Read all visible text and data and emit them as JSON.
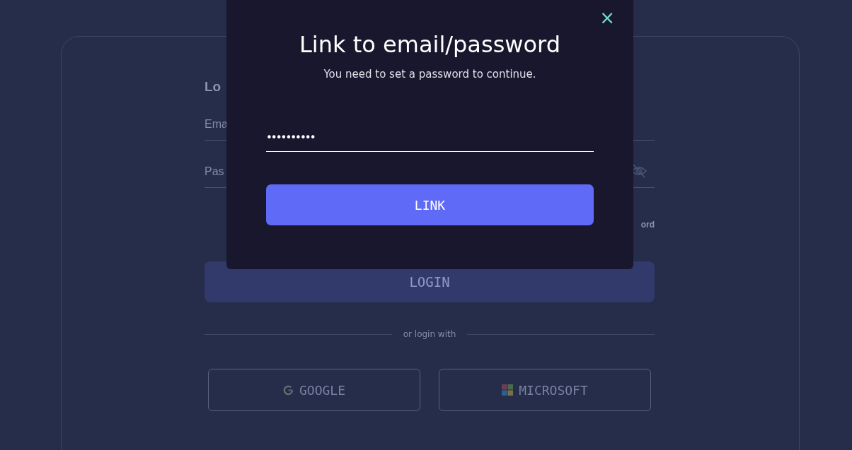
{
  "login_card": {
    "title": "Lo",
    "email_field": {
      "placeholder": "Ema"
    },
    "password_field": {
      "placeholder": "Pas"
    },
    "forgot_link": "ord",
    "login_button": {
      "label": "LOGIN",
      "disabled": true
    },
    "divider_text": "or login with",
    "social_buttons": [
      {
        "kind": "google",
        "label": "GOOGLE"
      },
      {
        "kind": "microsoft",
        "label": "MICROSOFT"
      }
    ]
  },
  "dialog": {
    "close": "×",
    "title": "Link to email/password",
    "subtitle": "You need to set a password to continue.",
    "password_value": "••••••••••",
    "button": "LINK"
  }
}
